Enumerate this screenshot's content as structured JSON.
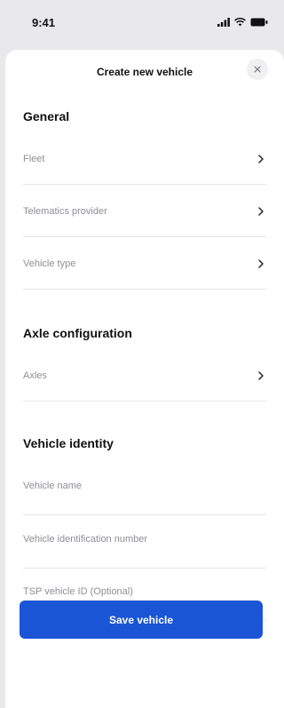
{
  "status_bar": {
    "time": "9:41",
    "icons": [
      "signal-icon",
      "wifi-icon",
      "battery-icon"
    ]
  },
  "header": {
    "title": "Create new vehicle",
    "close_icon": "close-icon"
  },
  "sections": {
    "general": {
      "title": "General",
      "rows": [
        {
          "label": "Fleet"
        },
        {
          "label": "Telematics provider"
        },
        {
          "label": "Vehicle type"
        }
      ]
    },
    "axle": {
      "title": "Axle configuration",
      "rows": [
        {
          "label": "Axles"
        }
      ]
    },
    "identity": {
      "title": "Vehicle identity",
      "fields": [
        {
          "value": "",
          "placeholder": "Vehicle name"
        },
        {
          "value": "",
          "placeholder": "Vehicle identification number"
        },
        {
          "value": "",
          "placeholder": "TSP vehicle ID (Optional)"
        }
      ]
    }
  },
  "save_button": {
    "label": "Save vehicle"
  },
  "colors": {
    "accent": "#1a55d6",
    "muted_text": "#8e8e96",
    "divider": "#e6e6ea"
  }
}
